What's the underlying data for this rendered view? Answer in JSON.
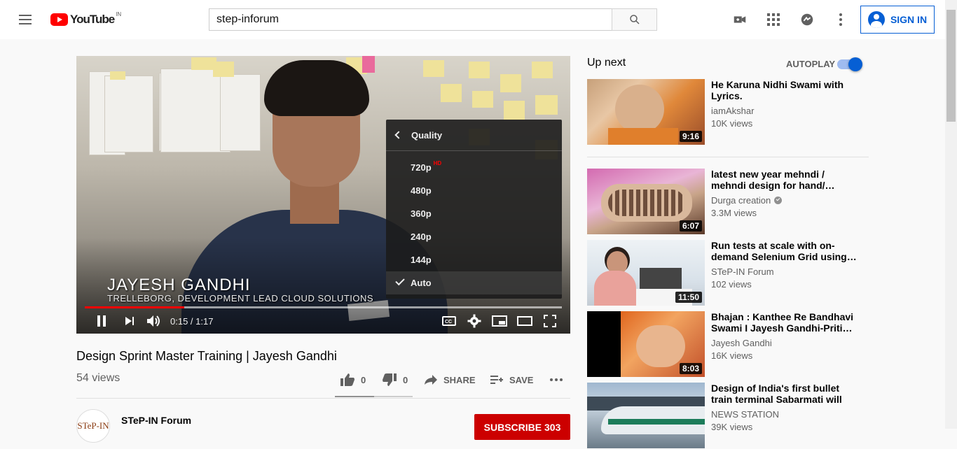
{
  "header": {
    "logo_text": "YouTube",
    "logo_region": "IN",
    "search_value": "step-inforum",
    "signin_label": "SIGN IN"
  },
  "player": {
    "overlay_name": "JAYESH GANDHI",
    "overlay_subtitle": "TRELLEBORG, DEVELOPMENT LEAD CLOUD SOLUTIONS",
    "time_display": "0:15 / 1:17",
    "played_fraction": 0.208,
    "loaded_fraction": 1.0,
    "quality_menu": {
      "header": "Quality",
      "options": [
        {
          "label": "720p",
          "badge": "HD",
          "selected": false
        },
        {
          "label": "480p",
          "badge": "",
          "selected": false
        },
        {
          "label": "360p",
          "badge": "",
          "selected": false
        },
        {
          "label": "240p",
          "badge": "",
          "selected": false
        },
        {
          "label": "144p",
          "badge": "",
          "selected": false
        },
        {
          "label": "Auto",
          "badge": "",
          "selected": true
        }
      ]
    }
  },
  "video": {
    "title": "Design Sprint Master Training | Jayesh Gandhi",
    "views": "54 views",
    "likes": "0",
    "dislikes": "0",
    "share_label": "SHARE",
    "save_label": "SAVE",
    "like_fraction": 0.5
  },
  "channel": {
    "name": "STeP-IN Forum",
    "avatar_text": "STeP-IN",
    "subscribe_label": "SUBSCRIBE",
    "subscriber_count": "303"
  },
  "sidebar": {
    "upnext_label": "Up next",
    "autoplay_label": "AUTOPLAY",
    "autoplay_on": true,
    "items": [
      {
        "title": "He Karuna Nidhi Swami with Lyrics.",
        "channel": "iamAkshar",
        "verified": false,
        "views": "10K views",
        "duration": "9:16"
      },
      {
        "title": "latest new year mehndi / mehndi design for hand/…",
        "channel": "Durga creation",
        "verified": true,
        "views": "3.3M views",
        "duration": "6:07"
      },
      {
        "title": "Run tests at scale with on-demand Selenium Grid using…",
        "channel": "STeP-IN Forum",
        "verified": false,
        "views": "102 views",
        "duration": "11:50"
      },
      {
        "title": "Bhajan : Kanthee Re Bandhavi Swami I Jayesh Gandhi-Priti…",
        "channel": "Jayesh Gandhi",
        "verified": false,
        "views": "16K views",
        "duration": "8:03"
      },
      {
        "title": "Design of India's first bullet train terminal Sabarmati will have t…",
        "channel": "NEWS STATION",
        "verified": false,
        "views": "39K views",
        "duration": ""
      }
    ]
  },
  "colors": {
    "brand_red": "#ff0000",
    "subscribe_red": "#cc0000",
    "link_blue": "#065fd4"
  }
}
